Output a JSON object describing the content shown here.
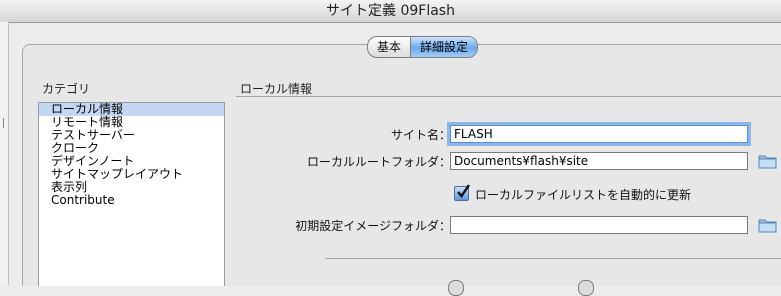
{
  "window": {
    "title": "サイト定義 09Flash"
  },
  "tabs": [
    {
      "label": "基本",
      "active": false
    },
    {
      "label": "詳細設定",
      "active": true
    }
  ],
  "categories": {
    "header": "カテゴリ",
    "items": [
      "ローカル情報",
      "リモート情報",
      "テストサーバー",
      "クローク",
      "デザインノート",
      "サイトマップレイアウト",
      "表示列",
      "Contribute"
    ],
    "selected_index": 0
  },
  "section": {
    "title": "ローカル情報"
  },
  "form": {
    "site_name": {
      "label": "サイト名：",
      "value": "FLASH"
    },
    "local_root": {
      "label": "ローカルルートフォルダ：",
      "value": "Documents¥flash¥site"
    },
    "auto_refresh": {
      "label": "ローカルファイルリストを自動的に更新",
      "checked": true
    },
    "default_images": {
      "label": "初期設定イメージフォルダ：",
      "value": ""
    }
  },
  "icons": {
    "folder": "folder-icon",
    "checkbox": "checkmark-icon"
  },
  "colors": {
    "selection": "#c3d6f3",
    "accent": "#6aa9ec"
  }
}
